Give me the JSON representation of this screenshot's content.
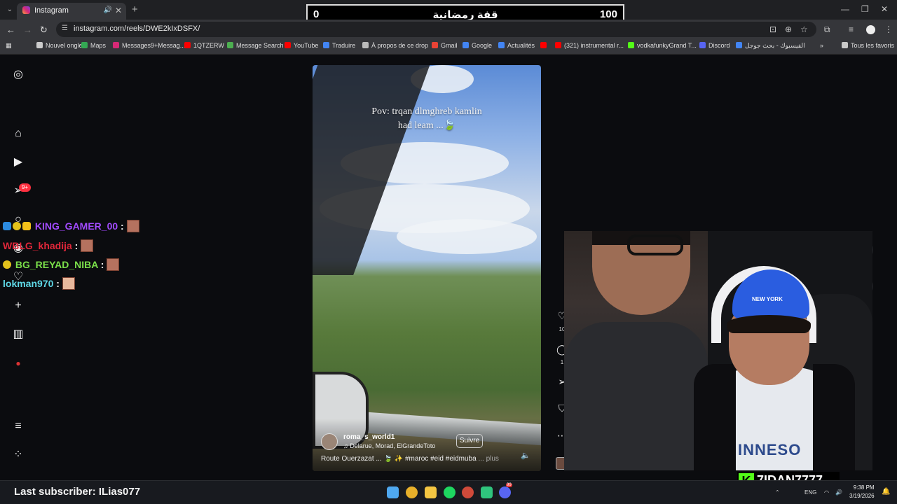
{
  "browser": {
    "tab_title": "Instagram",
    "url": "instagram.com/reels/DWE2kIxDSFX/",
    "bookmarks": [
      {
        "label": "Nouvel onglet",
        "color": "#cccccc"
      },
      {
        "label": "Maps",
        "color": "#34a853"
      },
      {
        "label": "Messages9+Messag...",
        "color": "#d62976"
      },
      {
        "label": "1QTZERW",
        "color": "#ff0000"
      },
      {
        "label": "Message Search",
        "color": "#4caf50"
      },
      {
        "label": "YouTube",
        "color": "#ff0000"
      },
      {
        "label": "Traduire",
        "color": "#4285f4"
      },
      {
        "label": "À propos de ce drop",
        "color": "#bbbbbb"
      },
      {
        "label": "Gmail",
        "color": "#ea4335"
      },
      {
        "label": "Google",
        "color": "#4285f4"
      },
      {
        "label": "Actualités",
        "color": "#4285f4"
      },
      {
        "label": "",
        "color": "#ff0000"
      },
      {
        "label": "(321) instrumental r...",
        "color": "#ff0000"
      },
      {
        "label": "vodkafunkyGrand T...",
        "color": "#53fc18"
      },
      {
        "label": "Discord",
        "color": "#5865f2"
      },
      {
        "label": "الفيسبوك - بحث جوجل",
        "color": "#4285f4"
      }
    ],
    "all_favorites": "Tous les favoris"
  },
  "overlay": {
    "score_left": "0",
    "score_title": "قفة رمضانية",
    "score_right": "100",
    "last_subscriber": "Last subscriber: ILias077",
    "streamer_name": "7IDAN7777"
  },
  "sidebar": {
    "notification_badge": "9+"
  },
  "chat": [
    {
      "name": "KING_GAMER_00",
      "color": "#a24bff"
    },
    {
      "name": "WBLG_khadija",
      "color": "#e0273a"
    },
    {
      "name": "BG_REYAD_NIBA",
      "color": "#7be04a"
    },
    {
      "name": "lokman970",
      "color": "#5fd8e6"
    }
  ],
  "reel": {
    "caption_line1": "Pov: trqan dlmghreb kamlin",
    "caption_line2": "had leam ...🍃",
    "username": "roma_s_world1",
    "music": "Delarue, Morad, ElGrandeToto",
    "follow_label": "Suivre",
    "description": "Route Ouerzazat ... 🍃 ✨ #maroc #eid #eidmuba",
    "more_label": "... plus",
    "like_count": "10",
    "comment_count": "1"
  },
  "taskbar": {
    "language": "ENG",
    "time": "9:38 PM",
    "date": "3/19/2026",
    "discord_badge": "99"
  }
}
